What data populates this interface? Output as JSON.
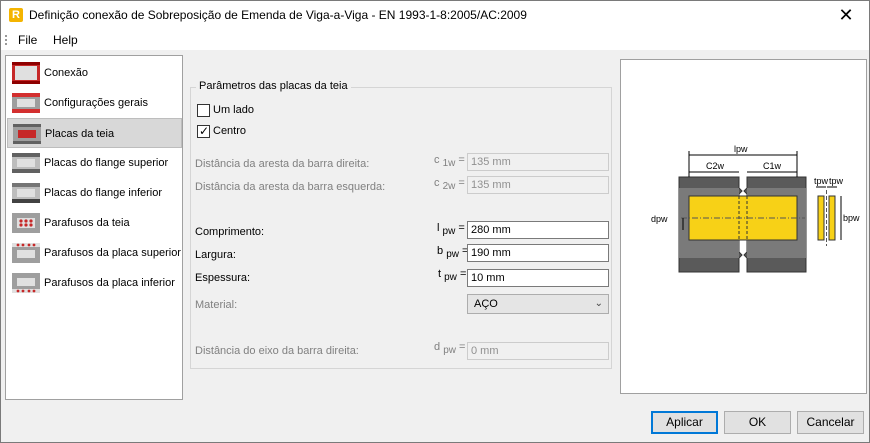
{
  "window": {
    "title": "Definição conexão de Sobreposição de Emenda de Viga-a-Viga - EN 1993-1-8:2005/AC:2009",
    "app_icon": "R",
    "close_glyph": "✕"
  },
  "menu": {
    "file": "File",
    "help": "Help"
  },
  "nav": {
    "items": [
      {
        "label": "Conexão",
        "icon": "connection-icon"
      },
      {
        "label": "Configurações gerais",
        "icon": "general-settings-icon"
      },
      {
        "label": "Placas da teia",
        "icon": "web-plates-icon"
      },
      {
        "label": "Placas do flange superior",
        "icon": "top-flange-plates-icon"
      },
      {
        "label": "Placas do flange inferior",
        "icon": "bottom-flange-plates-icon"
      },
      {
        "label": "Parafusos da teia",
        "icon": "web-bolts-icon"
      },
      {
        "label": "Parafusos da placa superior",
        "icon": "top-plate-bolts-icon"
      },
      {
        "label": "Parafusos da placa inferior",
        "icon": "bottom-plate-bolts-icon"
      }
    ],
    "selected_index": 2
  },
  "params": {
    "group_title": "Parâmetros das placas da teia",
    "one_side_label": "Um lado",
    "one_side_checked": false,
    "center_label": "Centro",
    "center_checked": true,
    "dist_right_label": "Distância da aresta da barra direita:",
    "dist_right_sym": "c",
    "dist_right_sub": "1w",
    "dist_right_value": "135 mm",
    "dist_left_label": "Distância da aresta da barra esquerda:",
    "dist_left_sym": "c",
    "dist_left_sub": "2w",
    "dist_left_value": "135 mm",
    "length_label": "Comprimento:",
    "length_sym": "l",
    "length_sub": "pw",
    "length_value": "280 mm",
    "width_label": "Largura:",
    "width_sym": "b",
    "width_sub": "pw",
    "width_value": "190 mm",
    "thickness_label": "Espessura:",
    "thickness_sym": "t",
    "thickness_sub": "pw",
    "thickness_value": "10 mm",
    "material_label": "Material:",
    "material_value": "AÇO",
    "axis_dist_label": "Distância do eixo da barra direita:",
    "axis_dist_sym": "d",
    "axis_dist_sub": "pw",
    "axis_dist_value": "0 mm",
    "equals": "="
  },
  "diagram": {
    "lpw": "lpw",
    "c2w": "C2w",
    "c1w": "C1w",
    "dpw": "dpw",
    "tpw1": "tpw",
    "tpw2": "tpw",
    "bpw": "bpw"
  },
  "buttons": {
    "apply": "Aplicar",
    "ok": "OK",
    "cancel": "Cancelar"
  }
}
